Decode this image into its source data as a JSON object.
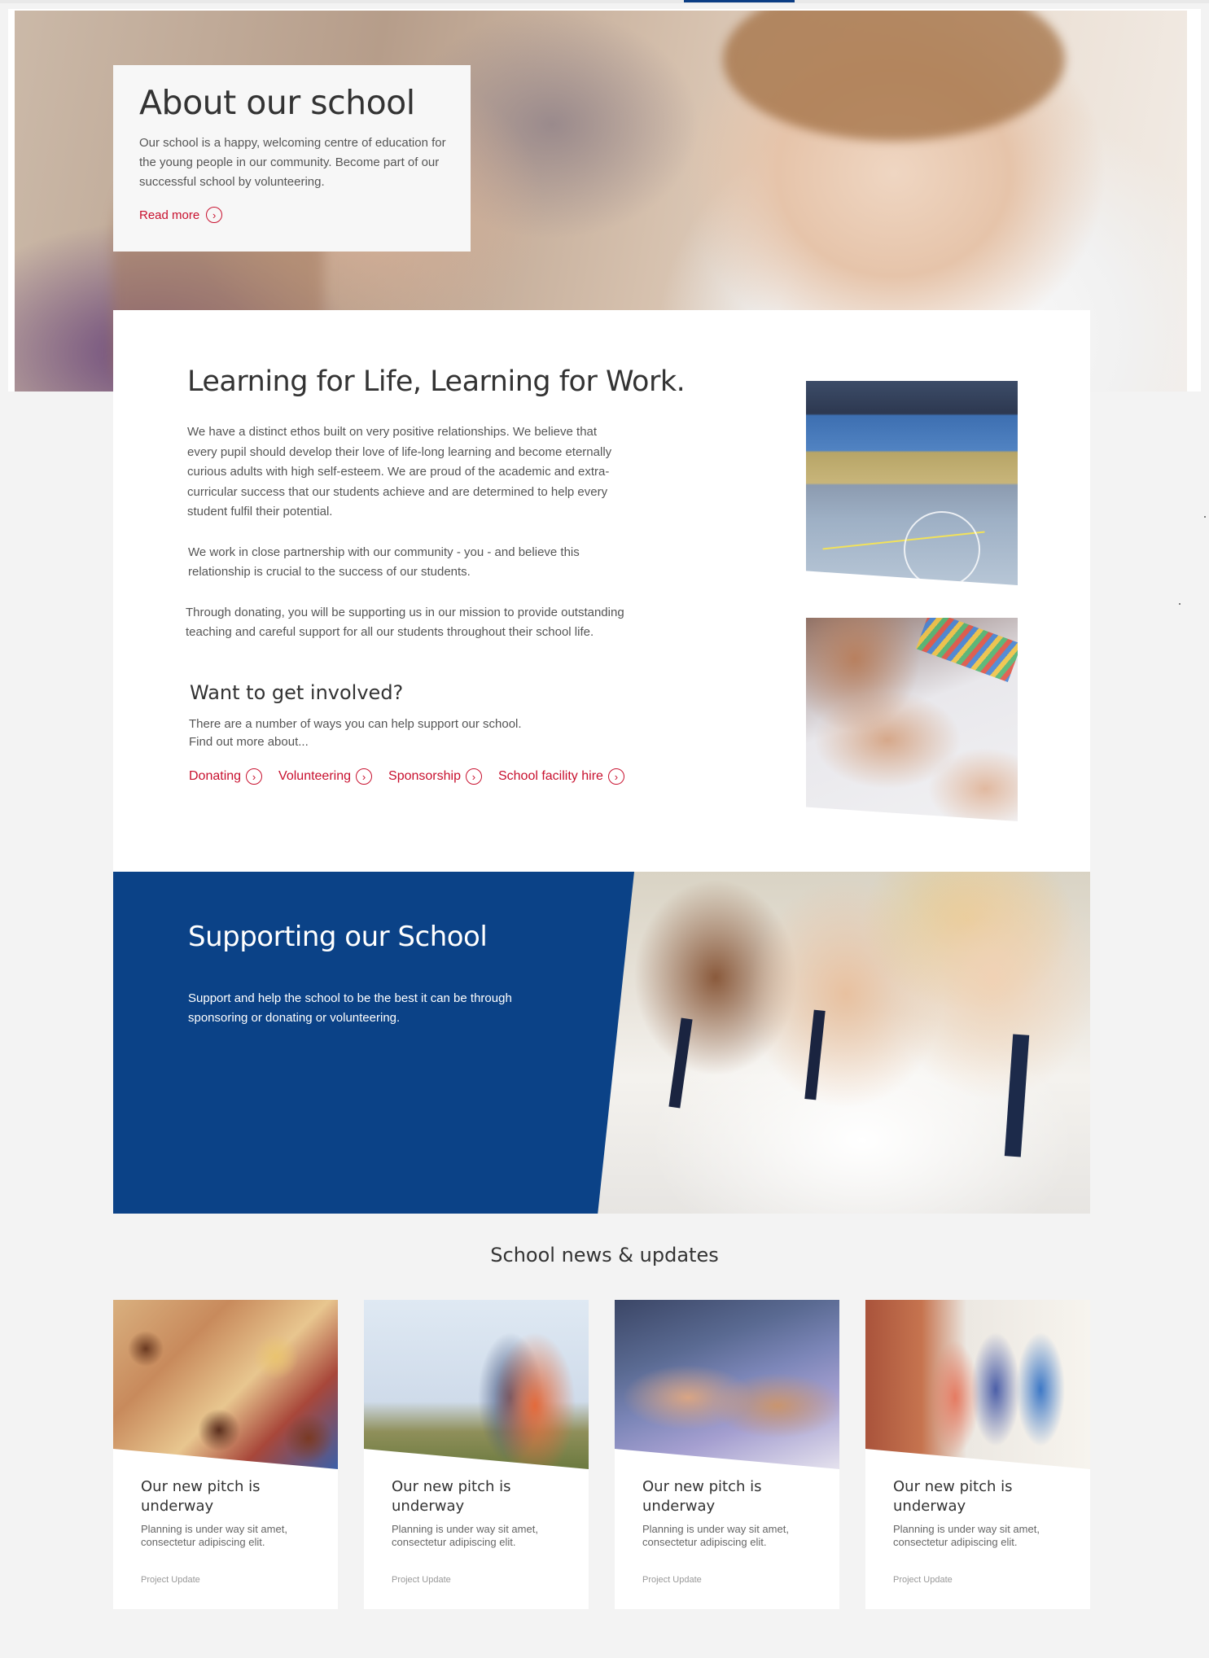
{
  "about": {
    "title": "About our school",
    "text": "Our school is a happy, welcoming centre of education for the young people in our community. Become part of our successful school by volunteering.",
    "read_more": "Read more",
    "read_more_icon": "chevron-right-circle-icon"
  },
  "learning": {
    "title": "Learning for Life, Learning for Work.",
    "paragraphs": [
      "We have a distinct ethos built on very positive relationships. We believe that every pupil should develop their love of life-long learning and become eternally curious adults with high self-esteem. We are proud of the academic and extra-curricular success that our students achieve and are determined to help every student fulfil their potential.",
      "We work in close partnership with our community - you - and believe this relationship is crucial to the success of our students.",
      "Through donating, you will be supporting us in our mission to provide outstanding teaching and careful support for all our students throughout their school life."
    ]
  },
  "involved": {
    "title": "Want to get involved?",
    "text_line1": "There are a number of ways you can help support our school.",
    "text_line2": "Find out more about...",
    "links": [
      {
        "label": "Donating"
      },
      {
        "label": "Volunteering"
      },
      {
        "label": "Sponsorship"
      },
      {
        "label": "School facility hire"
      }
    ]
  },
  "supporting": {
    "title": "Supporting our School",
    "text": "Support and help the school to be the best it can be through sponsoring or donating or volunteering."
  },
  "news": {
    "title": "School news & updates",
    "items": [
      {
        "headline": "Our new pitch is underway",
        "desc": "Planning is under way sit amet, consectetur adipiscing elit.",
        "tag": "Project Update"
      },
      {
        "headline": "Our new pitch is underway",
        "desc": "Planning is under way sit amet, consectetur adipiscing elit.",
        "tag": "Project Update"
      },
      {
        "headline": "Our new pitch is underway",
        "desc": "Planning is under way sit amet, consectetur adipiscing elit.",
        "tag": "Project Update"
      },
      {
        "headline": "Our new pitch is underway",
        "desc": "Planning is under way sit amet, consectetur adipiscing elit.",
        "tag": "Project Update"
      }
    ]
  },
  "colors": {
    "brand_blue": "#0b4287",
    "link_red": "#c8102e",
    "background": "#f3f3f3"
  }
}
